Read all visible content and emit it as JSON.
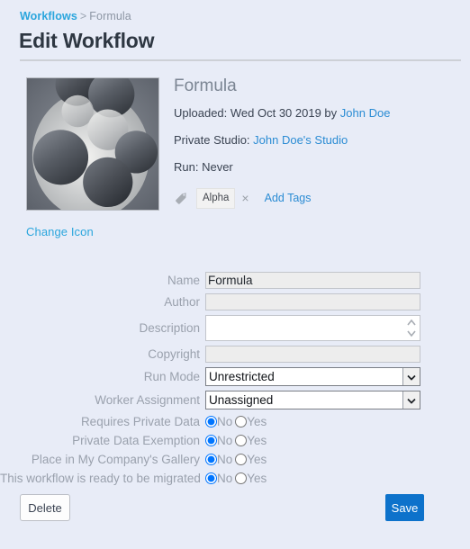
{
  "breadcrumb": {
    "root_label": "Workflows",
    "separator": ">",
    "current_label": "Formula"
  },
  "page": {
    "title": "Edit Workflow"
  },
  "summary": {
    "name": "Formula",
    "uploaded_prefix": "Uploaded: Wed Oct 30 2019 by ",
    "uploaded_user": "John Doe",
    "studio_prefix": "Private Studio: ",
    "studio_name": "John Doe's Studio",
    "run_text": "Run: Never",
    "change_icon_label": "Change Icon",
    "icon_alt": "workflow-icon-bubbles"
  },
  "tags": {
    "icon": "tag-icon",
    "items": [
      {
        "label": "Alpha",
        "remove_glyph": "×"
      }
    ],
    "add_label": "Add Tags"
  },
  "form": {
    "name": {
      "label": "Name",
      "value": "Formula",
      "placeholder": ""
    },
    "author": {
      "label": "Author",
      "value": "",
      "placeholder": ""
    },
    "description": {
      "label": "Description",
      "value": "",
      "placeholder": ""
    },
    "copyright": {
      "label": "Copyright",
      "value": "",
      "placeholder": ""
    },
    "run_mode": {
      "label": "Run Mode",
      "value": "Unrestricted",
      "options": [
        "Unrestricted"
      ]
    },
    "worker_assignment": {
      "label": "Worker Assignment",
      "value": "Unassigned",
      "options": [
        "Unassigned"
      ]
    },
    "radio_labels": {
      "no": "No",
      "yes": "Yes"
    },
    "radios": [
      {
        "label": "Requires Private Data",
        "selected": "No"
      },
      {
        "label": "Private Data Exemption",
        "selected": "No"
      },
      {
        "label": "Place in My Company's Gallery",
        "selected": "No"
      },
      {
        "label": "This workflow is ready to be migrated",
        "selected": "No"
      }
    ]
  },
  "footer": {
    "delete_label": "Delete",
    "save_label": "Save"
  },
  "colors": {
    "page_background": "#e8ecf7",
    "breadcrumb_link": "#2ba6dd",
    "body_link": "#2b8cd4",
    "save_button": "#0d72cb",
    "label_text": "#9aa1ad",
    "title_text": "#2e3742"
  }
}
